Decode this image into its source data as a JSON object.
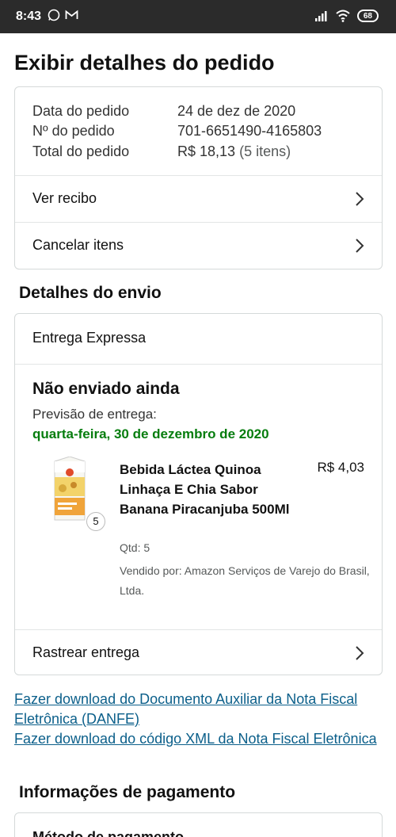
{
  "status_bar": {
    "time": "8:43",
    "battery": "68",
    "icons": [
      "whatsapp-icon",
      "gmail-icon",
      "signal-icon",
      "wifi-icon",
      "battery-icon"
    ]
  },
  "page": {
    "title": "Exibir detalhes do pedido"
  },
  "order_summary": {
    "date_label": "Data do pedido",
    "date_value": "24 de dez de 2020",
    "number_label": "Nº do pedido",
    "number_value": "701-6651490-4165803",
    "total_label": "Total do pedido",
    "total_value": "R$ 18,13",
    "total_items": "(5 itens)",
    "receipt_label": "Ver recibo",
    "cancel_label": "Cancelar itens"
  },
  "shipping": {
    "section_title": "Detalhes do envio",
    "type": "Entrega Expressa",
    "status": "Não enviado ainda",
    "eta_label": "Previsão de entrega:",
    "eta_date": "quarta-feira, 30 de dezembro de 2020",
    "item": {
      "name": "Bebida Láctea Quinoa Linhaça E Chia Sabor Banana Piracanjuba 500Ml",
      "price": "R$ 4,03",
      "qty_badge": "5",
      "qty_text": "Qtd: 5",
      "seller": "Vendido por: Amazon Serviços de Varejo do Brasil, Ltda."
    },
    "track_label": "Rastrear entrega"
  },
  "downloads": {
    "danfe_link": "Fazer download do Documento Auxiliar da Nota Fiscal Eletrônica (DANFE)",
    "xml_link": "Fazer download do código XML da Nota Fiscal Eletrônica"
  },
  "payment": {
    "section_title": "Informações de pagamento",
    "method_label": "Método de pagamento"
  },
  "colors": {
    "link": "#0b5f8a",
    "eta_green": "#067d0e",
    "status_bar": "#2b2b2b"
  }
}
